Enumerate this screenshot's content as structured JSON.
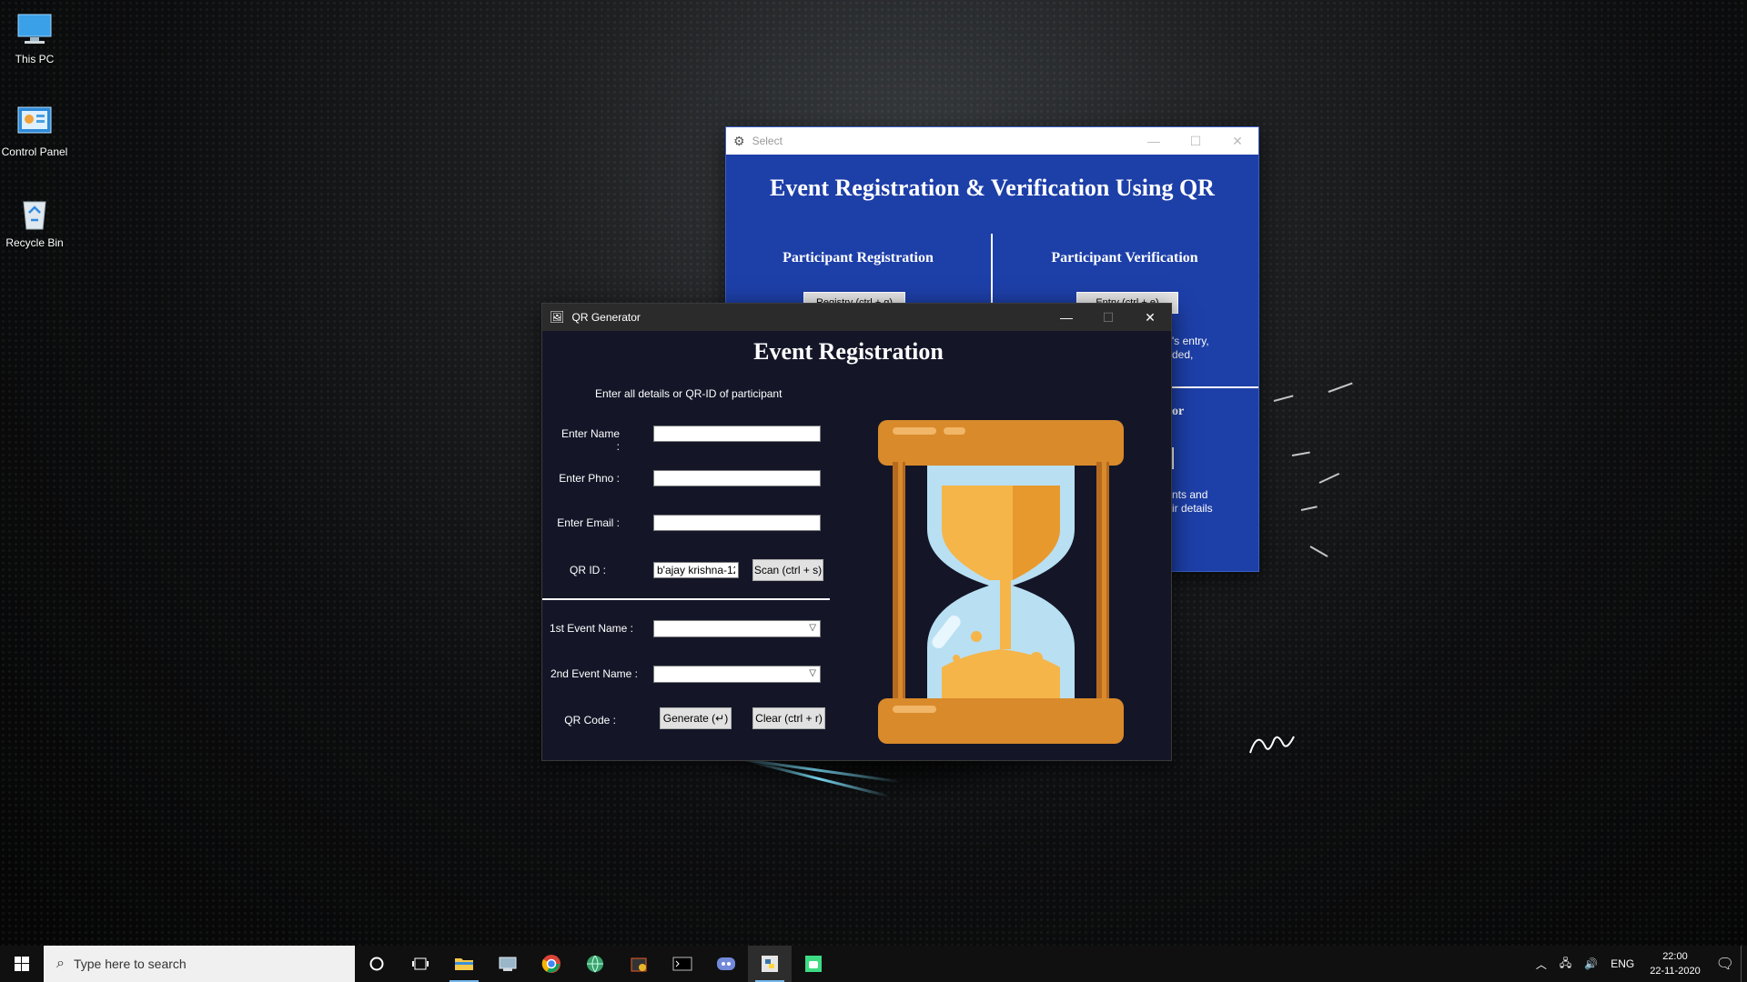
{
  "desktop": {
    "icons": [
      {
        "label": "This PC",
        "icon": "computer-icon"
      },
      {
        "label": "Control Panel",
        "icon": "control-panel-icon"
      },
      {
        "label": "Recycle Bin",
        "icon": "recycle-bin-icon"
      }
    ]
  },
  "select_window": {
    "title": "Select",
    "heading": "Event Registration & Verification Using QR",
    "left_col_title": "Participant Registration",
    "right_col_title": "Participant Verification",
    "registry_button": "Registry (ctrl + g)",
    "entry_button": "Entry (ctrl + e)",
    "right_text_line1": "'s entry,",
    "right_text_line2": "ded,",
    "lower_title_fragment": "or",
    "lower_text_line1": "nts and",
    "lower_text_line2": "ir details"
  },
  "qr_window": {
    "title": "QR Generator",
    "heading": "Event Registration",
    "subheading": "Enter all details or QR-ID of participant",
    "name_label": "Enter Name :",
    "name_value": "",
    "phone_label": "Enter Phno :",
    "phone_value": "",
    "email_label": "Enter Email :",
    "email_value": "",
    "qrid_label": "QR ID :",
    "qrid_value": "b'ajay krishna-12",
    "scan_button": "Scan (ctrl + s)",
    "event1_label": "1st Event Name :",
    "event1_value": "",
    "event2_label": "2nd Event Name :",
    "event2_value": "",
    "qrcode_label": "QR Code :",
    "generate_button": "Generate (↵)",
    "clear_button": "Clear (ctrl + r)"
  },
  "taskbar": {
    "search_placeholder": "Type here to search",
    "language": "ENG",
    "time": "22:00",
    "date": "22-11-2020"
  },
  "colors": {
    "select_bg": "#1d3fa8",
    "qr_bg": "#141628",
    "hourglass_frame": "#d98a2b",
    "hourglass_glass": "#b9dff2",
    "hourglass_sand": "#f5b549"
  }
}
